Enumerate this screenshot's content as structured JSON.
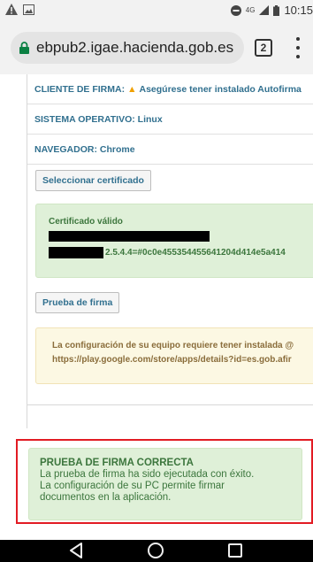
{
  "status_bar": {
    "network": "4G",
    "time": "10:15"
  },
  "browser": {
    "url": "ebpub2.igae.hacienda.gob.es",
    "tab_count": "2"
  },
  "page": {
    "cliente_label": "CLIENTE DE FIRMA:",
    "cliente_value": "Asegúrese tener instalado Autofirma",
    "sistema": "SISTEMA OPERATIVO: Linux",
    "navegador": "NAVEGADOR: Chrome",
    "select_cert_button": "Seleccionar certificado",
    "cert_title": "Certificado válido",
    "cert_oid": "2.5.4.4=#0c0e455354455641204d414e5a414",
    "prueba_button": "Prueba de firma",
    "config_line1": "La configuración de su equipo requiere tener instalada @",
    "config_line2": "https://play.google.com/store/apps/details?id=es.gob.afir",
    "success_title": "PRUEBA DE FIRMA CORRECTA",
    "success_line1": "La prueba de firma ha sido ejecutada con éxito.",
    "success_line2": "La configuración de su PC permite firmar",
    "success_line3": "documentos en la aplicación."
  },
  "colors": {
    "success_bg": "#dff0d8",
    "success_text": "#3c763d",
    "warning_bg": "#fcf8e3",
    "info_text": "#31708f",
    "highlight_border": "#e21b23"
  }
}
